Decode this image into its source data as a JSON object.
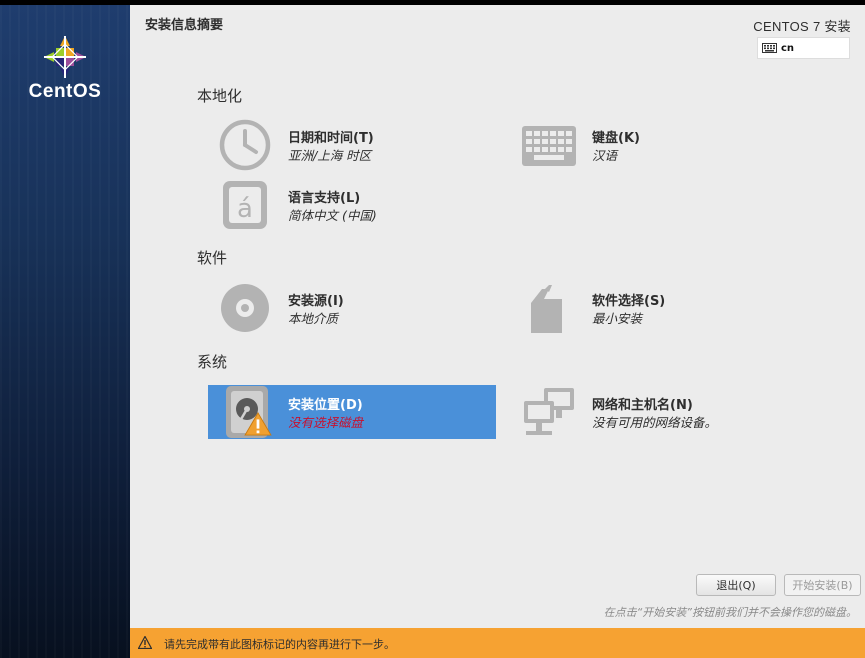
{
  "sidebar": {
    "logo_text": "CentOS"
  },
  "header": {
    "title": "安装信息摘要",
    "product": "CENTOS 7 安装",
    "keyboard_layout": "cn"
  },
  "sections": [
    {
      "label": "本地化"
    },
    {
      "label": "软件"
    },
    {
      "label": "系统"
    }
  ],
  "spokes": {
    "datetime": {
      "title": "日期和时间(T)",
      "status": "亚洲/上海 时区",
      "icon": "clock-icon"
    },
    "keyboard": {
      "title": "键盘(K)",
      "status": "汉语",
      "icon": "keyboard-icon"
    },
    "language": {
      "title": "语言支持(L)",
      "status": "简体中文 (中国)",
      "icon": "language-icon"
    },
    "source": {
      "title": "安装源(I)",
      "status": "本地介质",
      "icon": "disc-icon"
    },
    "software": {
      "title": "软件选择(S)",
      "status": "最小安装",
      "icon": "package-icon"
    },
    "destination": {
      "title": "安装位置(D)",
      "status": "没有选择磁盘",
      "icon": "harddisk-icon",
      "warning": true,
      "selected": true
    },
    "network": {
      "title": "网络和主机名(N)",
      "status": "没有可用的网络设备。",
      "icon": "network-icon"
    }
  },
  "buttons": {
    "quit": "退出(Q)",
    "begin": "开始安装(B)"
  },
  "hint": "在点击“开始安装”按钮前我们并不会操作您的磁盘。",
  "warning_bar": {
    "text": "请先完成带有此图标标记的内容再进行下一步。"
  },
  "colors": {
    "accent_selected": "#4a90d9",
    "warning": "#f6a232",
    "error_text": "#c8102e",
    "sidebar": "#183259"
  }
}
